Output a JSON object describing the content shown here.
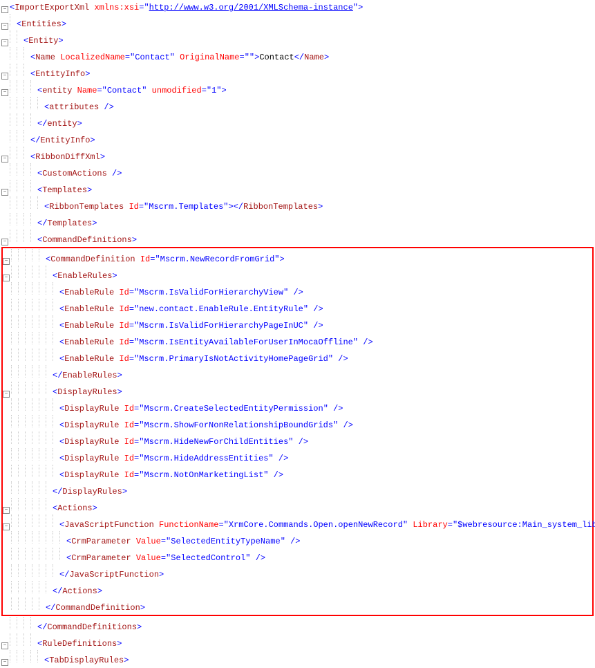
{
  "root": {
    "tag": "ImportExportXml",
    "attr": "xmlns:xsi",
    "url": "http://www.w3.org/2001/XMLSchema-instance"
  },
  "lines": [
    {
      "depth": 0,
      "exp": true,
      "t": "open-attr-url",
      "tag": "ImportExportXml",
      "aname": "xmlns:xsi",
      "aval": "http://www.w3.org/2001/XMLSchema-instance"
    },
    {
      "depth": 1,
      "exp": true,
      "t": "open",
      "tag": "Entities"
    },
    {
      "depth": 2,
      "exp": true,
      "t": "open",
      "tag": "Entity"
    },
    {
      "depth": 3,
      "exp": false,
      "t": "open-attrs-text",
      "tag": "Name",
      "attrs": [
        [
          "LocalizedName",
          "Contact"
        ],
        [
          "OriginalName",
          ""
        ]
      ],
      "text": "Contact"
    },
    {
      "depth": 3,
      "exp": true,
      "t": "open",
      "tag": "EntityInfo"
    },
    {
      "depth": 4,
      "exp": true,
      "t": "open-attrs",
      "tag": "entity",
      "attrs": [
        [
          "Name",
          "Contact"
        ],
        [
          "unmodified",
          "1"
        ]
      ]
    },
    {
      "depth": 5,
      "exp": false,
      "t": "self",
      "tag": "attributes"
    },
    {
      "depth": 4,
      "exp": false,
      "t": "close",
      "tag": "entity"
    },
    {
      "depth": 3,
      "exp": false,
      "t": "close",
      "tag": "EntityInfo"
    },
    {
      "depth": 3,
      "exp": true,
      "t": "open",
      "tag": "RibbonDiffXml"
    },
    {
      "depth": 4,
      "exp": false,
      "t": "self",
      "tag": "CustomActions"
    },
    {
      "depth": 4,
      "exp": true,
      "t": "open",
      "tag": "Templates"
    },
    {
      "depth": 5,
      "exp": false,
      "t": "open-attrs-close",
      "tag": "RibbonTemplates",
      "attrs": [
        [
          "Id",
          "Mscrm.Templates"
        ]
      ]
    },
    {
      "depth": 4,
      "exp": false,
      "t": "close",
      "tag": "Templates"
    },
    {
      "depth": 4,
      "exp": true,
      "t": "open",
      "tag": "CommandDefinitions"
    }
  ],
  "highlighted": [
    {
      "depth": 5,
      "exp": true,
      "t": "open-attrs",
      "tag": "CommandDefinition",
      "attrs": [
        [
          "Id",
          "Mscrm.NewRecordFromGrid"
        ]
      ]
    },
    {
      "depth": 6,
      "exp": true,
      "t": "open",
      "tag": "EnableRules"
    },
    {
      "depth": 7,
      "exp": false,
      "t": "self-attrs",
      "tag": "EnableRule",
      "attrs": [
        [
          "Id",
          "Mscrm.IsValidForHierarchyView"
        ]
      ]
    },
    {
      "depth": 7,
      "exp": false,
      "t": "self-attrs",
      "tag": "EnableRule",
      "attrs": [
        [
          "Id",
          "new.contact.EnableRule.EntityRule"
        ]
      ]
    },
    {
      "depth": 7,
      "exp": false,
      "t": "self-attrs",
      "tag": "EnableRule",
      "attrs": [
        [
          "Id",
          "Mscrm.IsValidForHierarchyPageInUC"
        ]
      ]
    },
    {
      "depth": 7,
      "exp": false,
      "t": "self-attrs",
      "tag": "EnableRule",
      "attrs": [
        [
          "Id",
          "Mscrm.IsEntityAvailableForUserInMocaOffline"
        ]
      ]
    },
    {
      "depth": 7,
      "exp": false,
      "t": "self-attrs",
      "tag": "EnableRule",
      "attrs": [
        [
          "Id",
          "Mscrm.PrimaryIsNotActivityHomePageGrid"
        ]
      ]
    },
    {
      "depth": 6,
      "exp": false,
      "t": "close",
      "tag": "EnableRules"
    },
    {
      "depth": 6,
      "exp": true,
      "t": "open",
      "tag": "DisplayRules"
    },
    {
      "depth": 7,
      "exp": false,
      "t": "self-attrs",
      "tag": "DisplayRule",
      "attrs": [
        [
          "Id",
          "Mscrm.CreateSelectedEntityPermission"
        ]
      ]
    },
    {
      "depth": 7,
      "exp": false,
      "t": "self-attrs",
      "tag": "DisplayRule",
      "attrs": [
        [
          "Id",
          "Mscrm.ShowForNonRelationshipBoundGrids"
        ]
      ]
    },
    {
      "depth": 7,
      "exp": false,
      "t": "self-attrs",
      "tag": "DisplayRule",
      "attrs": [
        [
          "Id",
          "Mscrm.HideNewForChildEntities"
        ]
      ]
    },
    {
      "depth": 7,
      "exp": false,
      "t": "self-attrs",
      "tag": "DisplayRule",
      "attrs": [
        [
          "Id",
          "Mscrm.HideAddressEntities"
        ]
      ]
    },
    {
      "depth": 7,
      "exp": false,
      "t": "self-attrs",
      "tag": "DisplayRule",
      "attrs": [
        [
          "Id",
          "Mscrm.NotOnMarketingList"
        ]
      ]
    },
    {
      "depth": 6,
      "exp": false,
      "t": "close",
      "tag": "DisplayRules"
    },
    {
      "depth": 6,
      "exp": true,
      "t": "open",
      "tag": "Actions"
    },
    {
      "depth": 7,
      "exp": true,
      "t": "open-attrs",
      "tag": "JavaScriptFunction",
      "attrs": [
        [
          "FunctionName",
          "XrmCore.Commands.Open.openNewRecord"
        ],
        [
          "Library",
          "$webresource:Main_system_library.js"
        ]
      ]
    },
    {
      "depth": 8,
      "exp": false,
      "t": "self-attrs",
      "tag": "CrmParameter",
      "attrs": [
        [
          "Value",
          "SelectedEntityTypeName"
        ]
      ]
    },
    {
      "depth": 8,
      "exp": false,
      "t": "self-attrs",
      "tag": "CrmParameter",
      "attrs": [
        [
          "Value",
          "SelectedControl"
        ]
      ]
    },
    {
      "depth": 7,
      "exp": false,
      "t": "close",
      "tag": "JavaScriptFunction"
    },
    {
      "depth": 6,
      "exp": false,
      "t": "close",
      "tag": "Actions"
    },
    {
      "depth": 5,
      "exp": false,
      "t": "close",
      "tag": "CommandDefinition"
    }
  ],
  "after": [
    {
      "depth": 4,
      "exp": false,
      "t": "close",
      "tag": "CommandDefinitions"
    },
    {
      "depth": 4,
      "exp": true,
      "t": "open",
      "tag": "RuleDefinitions"
    },
    {
      "depth": 5,
      "exp": true,
      "t": "open",
      "tag": "TabDisplayRules"
    }
  ]
}
